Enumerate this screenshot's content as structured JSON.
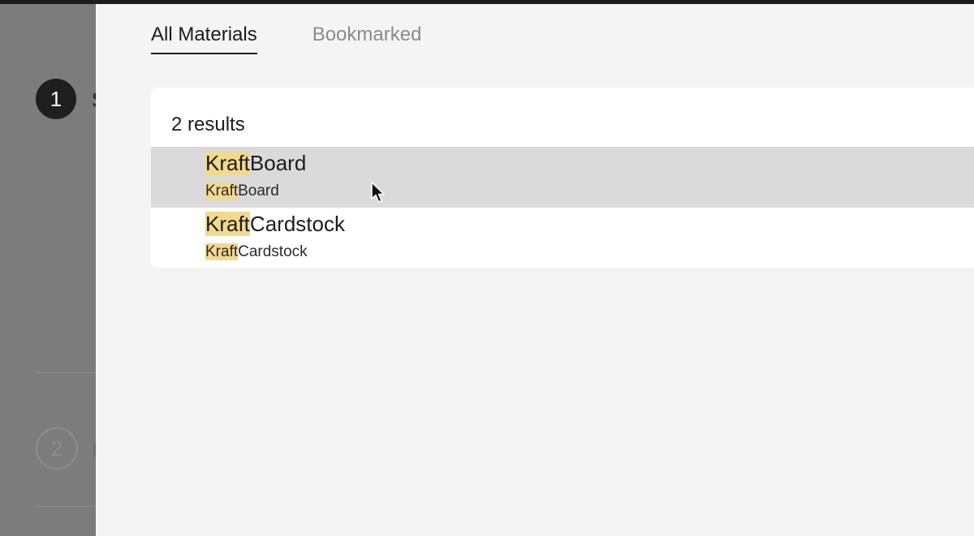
{
  "background_page": {
    "step1_number": "1",
    "step1_text": "S",
    "step2_number": "2",
    "step2_text": "I"
  },
  "tabs": [
    {
      "label": "All Materials",
      "active": true
    },
    {
      "label": "Bookmarked",
      "active": false
    }
  ],
  "results": {
    "count_label": "2 results",
    "items": [
      {
        "match": "Kraft",
        "rest": "Board",
        "sub_match": "Kraft",
        "sub_rest": "Board",
        "hovered": true
      },
      {
        "match": "Kraft",
        "rest": "Cardstock",
        "sub_match": "Kraft",
        "sub_rest": "Cardstock",
        "hovered": false
      }
    ]
  },
  "colors": {
    "highlight": "#f1d98e",
    "hover_row": "#dadada",
    "panel_bg": "#f4f4f4"
  },
  "icons": {
    "cursor": "mouse-pointer-icon"
  }
}
